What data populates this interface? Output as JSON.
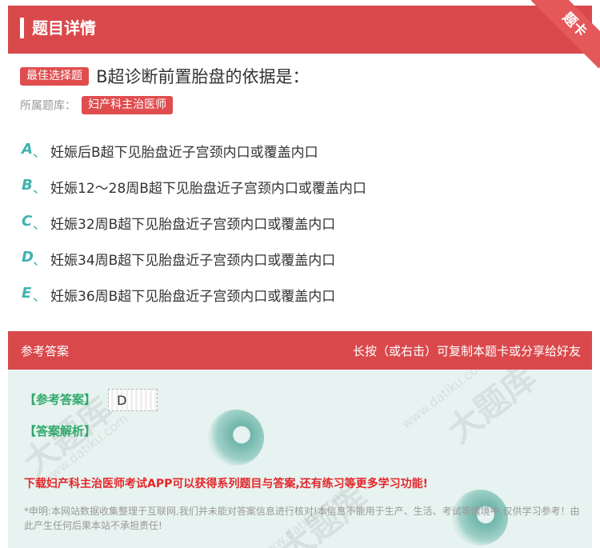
{
  "header": {
    "title": "题目详情",
    "corner_label": "题卡"
  },
  "question": {
    "type_tag": "最佳选择题",
    "text": "B超诊断前置胎盘的依据是：",
    "library_label": "所属题库：",
    "library_name": "妇产科主治医师"
  },
  "options": [
    {
      "letter": "A",
      "sep": "、",
      "text": "妊娠后B超下见胎盘近子宫颈内口或覆盖内口"
    },
    {
      "letter": "B",
      "sep": "、",
      "text": "妊娠12～28周B超下见胎盘近子宫颈内口或覆盖内口"
    },
    {
      "letter": "C",
      "sep": "、",
      "text": "妊娠32周B超下见胎盘近子宫颈内口或覆盖内口"
    },
    {
      "letter": "D",
      "sep": "、",
      "text": "妊娠34周B超下见胎盘近子宫颈内口或覆盖内口"
    },
    {
      "letter": "E",
      "sep": "、",
      "text": "妊娠36周B超下见胎盘近子宫颈内口或覆盖内口"
    }
  ],
  "answer_bar": {
    "left": "参考答案",
    "right": "长按（或右击）可复制本题卡或分享给好友"
  },
  "answer": {
    "answer_label": "【参考答案】",
    "answer_value": "D",
    "analysis_label": "【答案解析】",
    "promo": "下载妇产科主治医师考试APP可以获得系列题目与答案,还有练习等更多学习功能!",
    "note": "*申明:本网站数据收集整理于互联网,我们并未能对答案信息进行核对!本信息不能用于生产、生活、考试等情境中,仅供学习参考！由此产生任何后果本站不承担责任!"
  },
  "watermark": {
    "text": "大题库",
    "url": "www.datiku.com"
  },
  "colors": {
    "brand_red": "#d9494c",
    "option_teal": "#3fb3ae",
    "answer_bg": "#e7f3f0",
    "promo_red": "#e5262a"
  }
}
